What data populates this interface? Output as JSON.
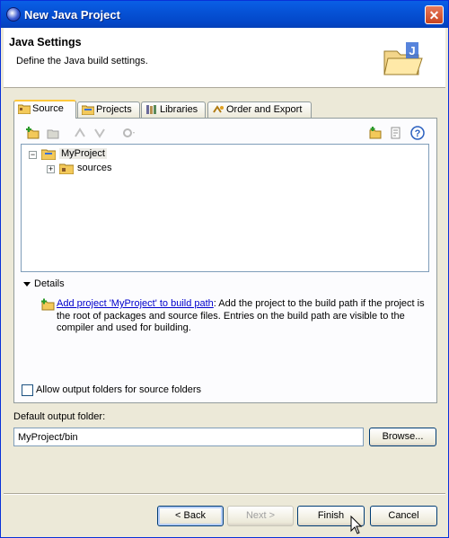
{
  "window": {
    "title": "New Java Project",
    "close_glyph": "✕"
  },
  "header": {
    "title": "Java Settings",
    "description": "Define the Java build settings."
  },
  "tabs": [
    {
      "label": "Source",
      "icon": "source-folder-icon",
      "active": true
    },
    {
      "label": "Projects",
      "icon": "projects-icon",
      "active": false
    },
    {
      "label": "Libraries",
      "icon": "libraries-icon",
      "active": false
    },
    {
      "label": "Order and Export",
      "icon": "order-export-icon",
      "active": false
    }
  ],
  "tree": {
    "root": {
      "label": "MyProject",
      "expander": "−"
    },
    "child": {
      "label": "sources",
      "expander": "+"
    }
  },
  "details": {
    "heading": "Details",
    "link": "Add project 'MyProject' to build path",
    "text": ": Add the project to the build path if the project is the root of packages and source files. Entries on the build path are visible to the compiler and used for building."
  },
  "allow_output_folders": {
    "label": "Allow output folders for source folders",
    "checked": false
  },
  "output": {
    "label": "Default output folder:",
    "value": "MyProject/bin",
    "browse": "Browse..."
  },
  "buttons": {
    "back": "< Back",
    "next": "Next >",
    "finish": "Finish",
    "cancel": "Cancel"
  },
  "colors": {
    "titlebar": "#0a5fe6",
    "link": "#0000cc",
    "tab_highlight": "#ffc83c"
  }
}
